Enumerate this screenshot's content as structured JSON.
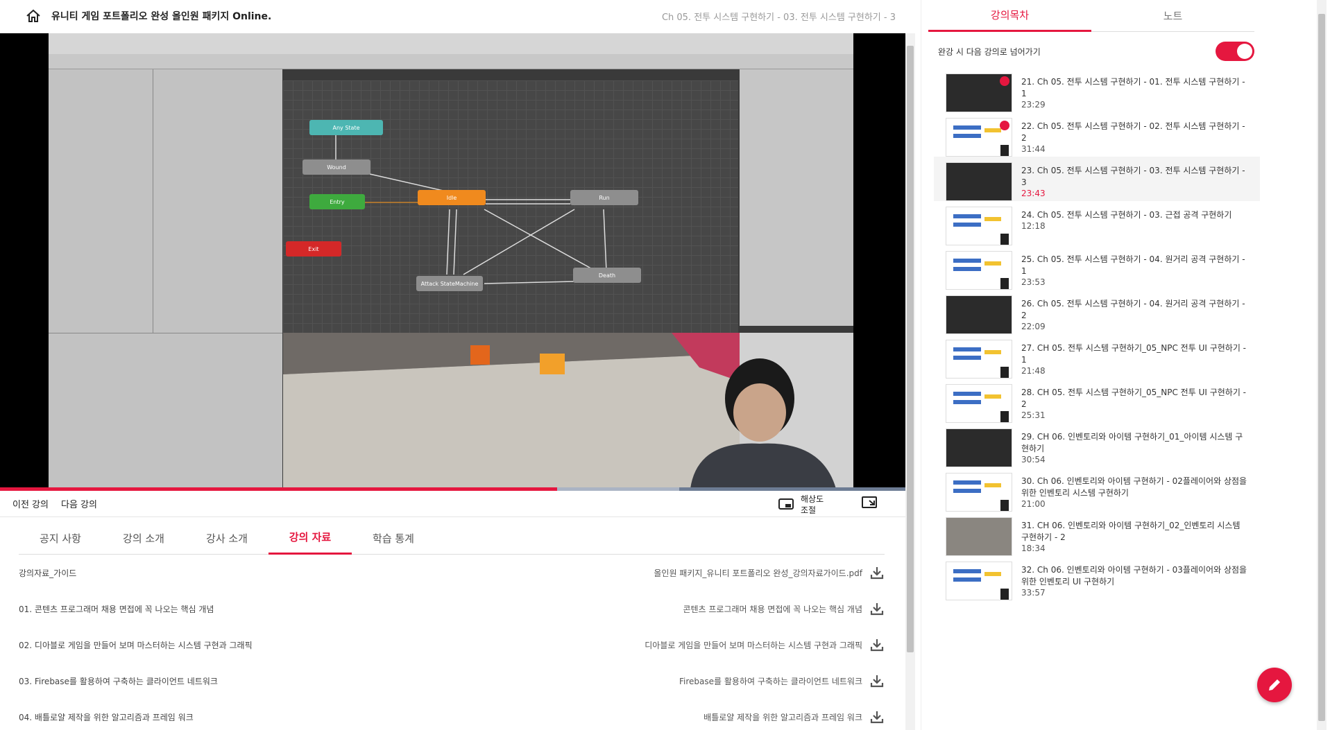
{
  "header": {
    "course_title": "유니티 게임 포트폴리오 완성 올인원 패키지 Online.",
    "lecture_crumb": "Ch 05. 전투 시스템 구현하기 - 03. 전투 시스템 구현하기 - 3"
  },
  "player": {
    "progress": 0.615,
    "buffered": 0.75,
    "prev_label": "이전 강의",
    "next_label": "다음 강의",
    "resolution_label": "해상도 조절"
  },
  "tabs": [
    {
      "label": "공지 사항",
      "active": false
    },
    {
      "label": "강의 소개",
      "active": false
    },
    {
      "label": "강사 소개",
      "active": false
    },
    {
      "label": "강의 자료",
      "active": true
    },
    {
      "label": "학습 통계",
      "active": false
    }
  ],
  "materials": [
    {
      "title": "강의자료_가이드",
      "file": "올인원 패키지_유니티 포트폴리오 완성_강의자료가이드.pdf"
    },
    {
      "title": "01. 콘텐츠 프로그래머 채용 면접에 꼭 나오는 핵심 개념",
      "file": "콘텐츠 프로그래머 채용 면접에 꼭 나오는 핵심 개념"
    },
    {
      "title": "02. 디아블로 게임을 만들어 보며 마스터하는 시스템 구현과 그래픽",
      "file": "디아블로 게임을 만들어 보며 마스터하는 시스템 구현과 그래픽"
    },
    {
      "title": "03. Firebase를 활용하여 구축하는 클라이언트 네트워크",
      "file": "Firebase를 활용하여 구축하는 클라이언트 네트워크"
    },
    {
      "title": "04. 배틀로얄 제작을 위한 알고리즘과 프레임 워크",
      "file": "배틀로얄 제작을 위한 알고리즘과 프레임 워크"
    }
  ],
  "sidebar": {
    "tab_curriculum": "강의목차",
    "tab_notes": "노트",
    "autonext_label": "완강 시 다음 강의로 넘어가기",
    "autonext_on": true,
    "accent": "#e5173f",
    "items": [
      {
        "title": "21. Ch 05. 전투 시스템 구현하기 - 01. 전투 시스템 구현하기 - 1",
        "duration": "23:29",
        "done": true,
        "current": false
      },
      {
        "title": "22. Ch 05. 전투 시스템 구현하기 - 02. 전투 시스템 구현하기 - 2",
        "duration": "31:44",
        "done": true,
        "current": false
      },
      {
        "title": "23. Ch 05. 전투 시스템 구현하기 - 03. 전투 시스템 구현하기 - 3",
        "duration": "23:43",
        "done": false,
        "current": true
      },
      {
        "title": "24. Ch 05. 전투 시스템 구현하기 - 03. 근접 공격 구현하기",
        "duration": "12:18",
        "done": false,
        "current": false
      },
      {
        "title": "25. Ch 05. 전투 시스템 구현하기 - 04. 원거리 공격 구현하기 - 1",
        "duration": "23:53",
        "done": false,
        "current": false
      },
      {
        "title": "26. Ch 05. 전투 시스템 구현하기 - 04. 원거리 공격 구현하기 - 2",
        "duration": "22:09",
        "done": false,
        "current": false
      },
      {
        "title": "27. CH 05. 전투 시스템 구현하기_05_NPC 전투 UI 구현하기 - 1",
        "duration": "21:48",
        "done": false,
        "current": false
      },
      {
        "title": "28. CH 05. 전투 시스템 구현하기_05_NPC 전투 UI 구현하기 - 2",
        "duration": "25:31",
        "done": false,
        "current": false
      },
      {
        "title": "29. CH 06. 인벤토리와 아이템 구현하기_01_아이템 시스템 구현하기",
        "duration": "30:54",
        "done": false,
        "current": false
      },
      {
        "title": "30. Ch 06. 인벤토리와 아이템 구현하기 - 02플레이어와 상점을 위한 인벤토리 시스템 구현하기",
        "duration": "21:00",
        "done": false,
        "current": false
      },
      {
        "title": "31. CH 06. 인벤토리와 아이템 구현하기_02_인벤토리 시스템 구현하기 - 2",
        "duration": "18:34",
        "done": false,
        "current": false
      },
      {
        "title": "32. Ch 06. 인벤토리와 아이템 구현하기 - 03플레이어와 상점을 위한 인벤토리 UI 구현하기",
        "duration": "33:57",
        "done": false,
        "current": false
      }
    ]
  },
  "video_mock": {
    "nodes": [
      "Any State",
      "Wound",
      "Entry",
      "Idle",
      "Run",
      "Exit",
      "Attack StateMachine",
      "Death"
    ]
  }
}
